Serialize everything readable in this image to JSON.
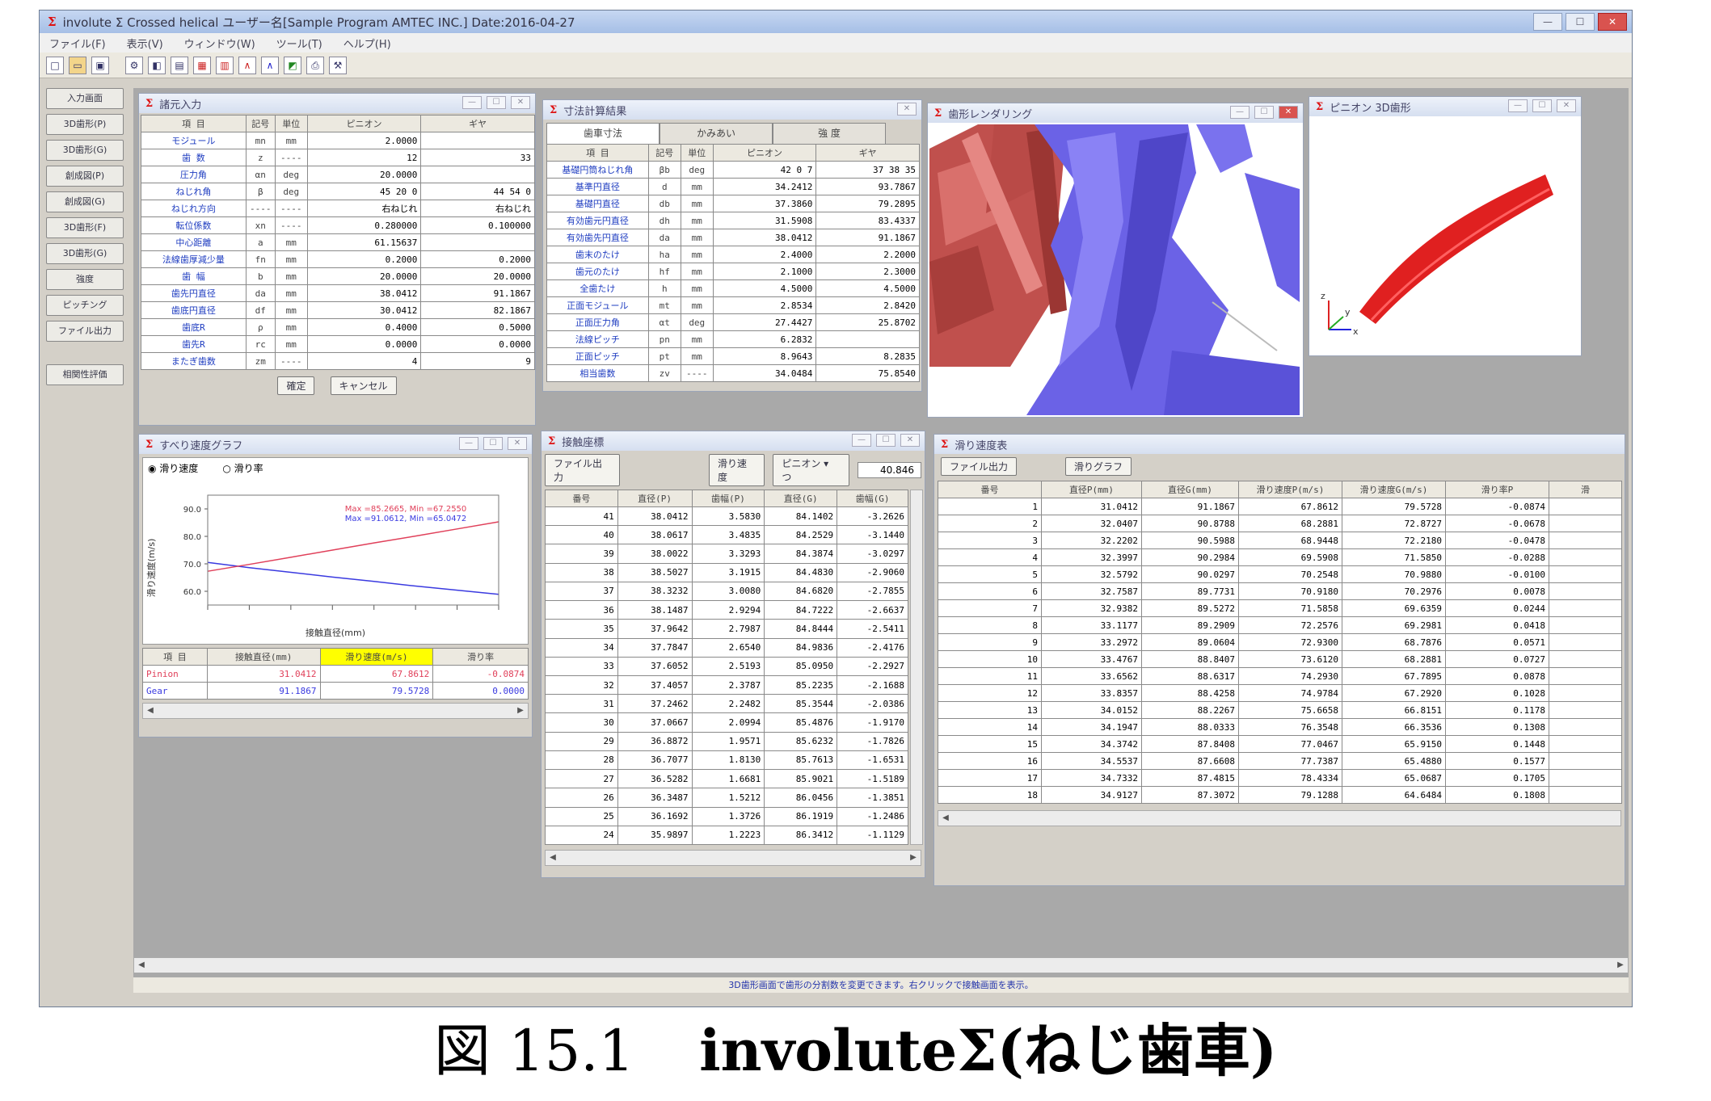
{
  "app": {
    "title": "involute Σ Crossed helical  ユーザー名[Sample Program AMTEC INC.]  Date:2016-04-27",
    "menus": [
      "ファイル(F)",
      "表示(V)",
      "ウィンドウ(W)",
      "ツール(T)",
      "ヘルプ(H)"
    ],
    "toolbar_icons": [
      "new-file-icon",
      "open-folder-icon",
      "save-icon",
      "gear-image-icon",
      "tool-1-icon",
      "tool-2-icon",
      "graph-1-icon",
      "graph-2-icon",
      "graph-3-icon",
      "graph-4-icon",
      "graph-5-icon",
      "print-icon",
      "settings-icon"
    ],
    "status": "3D歯形画面で歯形の分割数を変更できます。右クリックで接触画面を表示。"
  },
  "left_buttons": [
    "入力画面",
    "3D歯形(P)",
    "3D歯形(G)",
    "創成図(P)",
    "創成図(G)",
    "3D歯形(F)",
    "3D歯形(G)",
    "強度",
    "ピッチング",
    "ファイル出力",
    "相関性評価"
  ],
  "input_panel": {
    "title": "諸元入力",
    "headers": [
      "項 目",
      "記号",
      "単位",
      "ピニオン",
      "ギヤ"
    ],
    "rows": [
      {
        "label": "モジュール",
        "sym": "mn",
        "unit": "mm",
        "p": "2.0000",
        "g": ""
      },
      {
        "label": "歯 数",
        "sym": "z",
        "unit": "----",
        "p": "12",
        "g": "33"
      },
      {
        "label": "圧力角",
        "sym": "αn",
        "unit": "deg",
        "p": "20.0000",
        "g": ""
      },
      {
        "label": "ねじれ角",
        "sym": "β",
        "unit": "deg",
        "p": "45  20  0",
        "g": "44  54  0"
      },
      {
        "label": "ねじれ方向",
        "sym": "----",
        "unit": "----",
        "p": "右ねじれ",
        "g": "右ねじれ"
      },
      {
        "label": "転位係数",
        "sym": "xn",
        "unit": "----",
        "p": "0.280000",
        "g": "0.100000"
      },
      {
        "label": "中心距離",
        "sym": "a",
        "unit": "mm",
        "p": "61.15637",
        "g": ""
      },
      {
        "label": "法線歯厚減少量",
        "sym": "fn",
        "unit": "mm",
        "p": "0.2000",
        "g": "0.2000"
      },
      {
        "label": "歯 幅",
        "sym": "b",
        "unit": "mm",
        "p": "20.0000",
        "g": "20.0000"
      },
      {
        "label": "歯先円直径",
        "sym": "da",
        "unit": "mm",
        "p": "38.0412",
        "g": "91.1867"
      },
      {
        "label": "歯底円直径",
        "sym": "df",
        "unit": "mm",
        "p": "30.0412",
        "g": "82.1867"
      },
      {
        "label": "歯底R",
        "sym": "ρ",
        "unit": "mm",
        "p": "0.4000",
        "g": "0.5000"
      },
      {
        "label": "歯先R",
        "sym": "rc",
        "unit": "mm",
        "p": "0.0000",
        "g": "0.0000"
      },
      {
        "label": "またぎ歯数",
        "sym": "zm",
        "unit": "----",
        "p": "4",
        "g": "9"
      }
    ],
    "ok_label": "確定",
    "cancel_label": "キャンセル"
  },
  "dim_panel": {
    "title": "寸法計算結果",
    "tabs": [
      "歯車寸法",
      "かみあい",
      "強 度"
    ],
    "headers": [
      "項 目",
      "記号",
      "単位",
      "ピニオン",
      "ギヤ"
    ],
    "rows": [
      {
        "label": "基礎円筒ねじれ角",
        "sym": "βb",
        "unit": "deg",
        "p": "42  0  7",
        "g": "37  38  35"
      },
      {
        "label": "基準円直径",
        "sym": "d",
        "unit": "mm",
        "p": "34.2412",
        "g": "93.7867"
      },
      {
        "label": "基礎円直径",
        "sym": "db",
        "unit": "mm",
        "p": "37.3860",
        "g": "79.2895"
      },
      {
        "label": "有効歯元円直径",
        "sym": "dh",
        "unit": "mm",
        "p": "31.5908",
        "g": "83.4337"
      },
      {
        "label": "有効歯先円直径",
        "sym": "da",
        "unit": "mm",
        "p": "38.0412",
        "g": "91.1867"
      },
      {
        "label": "歯末のたけ",
        "sym": "ha",
        "unit": "mm",
        "p": "2.4000",
        "g": "2.2000"
      },
      {
        "label": "歯元のたけ",
        "sym": "hf",
        "unit": "mm",
        "p": "2.1000",
        "g": "2.3000"
      },
      {
        "label": "全歯たけ",
        "sym": "h",
        "unit": "mm",
        "p": "4.5000",
        "g": "4.5000"
      },
      {
        "label": "正面モジュール",
        "sym": "mt",
        "unit": "mm",
        "p": "2.8534",
        "g": "2.8420"
      },
      {
        "label": "正面圧力角",
        "sym": "αt",
        "unit": "deg",
        "p": "27.4427",
        "g": "25.8702"
      },
      {
        "label": "法線ピッチ",
        "sym": "pn",
        "unit": "mm",
        "p": "6.2832",
        "g": ""
      },
      {
        "label": "正面ピッチ",
        "sym": "pt",
        "unit": "mm",
        "p": "8.9643",
        "g": "8.2835"
      },
      {
        "label": "相当歯数",
        "sym": "zv",
        "unit": "----",
        "p": "34.0484",
        "g": "75.8540"
      }
    ]
  },
  "render_panel": {
    "title": "歯形レンダリング"
  },
  "pinion3d_panel": {
    "title": "ピニオン 3D歯形",
    "axis_x": "x",
    "axis_y": "y",
    "axis_z": "z"
  },
  "slip_graph": {
    "title": "すべり速度グラフ",
    "radio_velocity": "滑り速度",
    "radio_ratio": "滑り率",
    "ylabel": "滑り速度(m/s)",
    "xlabel": "接触直径(mm)",
    "legend_pinion": "Max =85.2665,  Min =67.2550",
    "legend_gear": "Max =91.0612,  Min =65.0472",
    "table_headers": [
      "項 目",
      "接触直径(mm)",
      "滑り速度(m/s)",
      "滑り率"
    ],
    "table_rows": [
      {
        "name": "Pinion",
        "d": "31.0412",
        "v": "67.8612",
        "r": "-0.0874"
      },
      {
        "name": "Gear",
        "d": "91.1867",
        "v": "79.5728",
        "r": "0.0000"
      }
    ]
  },
  "chart_data": {
    "type": "line",
    "title": "",
    "xlabel": "接触直径(mm)",
    "ylabel": "滑り速度(m/s)",
    "y_ticks": [
      "90.0",
      "80.0",
      "70.0",
      "60.0"
    ],
    "x_tick_count": 8,
    "ylim": [
      55,
      95
    ],
    "x": [
      0,
      1,
      2,
      3,
      4,
      5,
      6,
      7
    ],
    "series": [
      {
        "color": "#e0405a",
        "values": [
          67.3,
          69.8,
          72.4,
          75.0,
          77.6,
          80.1,
          82.7,
          85.3
        ]
      },
      {
        "color": "#3a3ae0",
        "values": [
          70.5,
          68.6,
          66.9,
          65.2,
          63.6,
          61.9,
          60.4,
          58.9
        ]
      }
    ]
  },
  "contact_panel": {
    "title": "接触座標",
    "file_btn": "ファイル出力",
    "slip_btn": "滑り速度",
    "selector": "ピニオン ▾ つ",
    "value": "40.846",
    "headers": [
      "番号",
      "直径(P)",
      "歯幅(P)",
      "直径(G)",
      "歯幅(G)"
    ],
    "rows": [
      [
        "41",
        "38.0412",
        "3.5830",
        "84.1402",
        "-3.2626"
      ],
      [
        "40",
        "38.0617",
        "3.4835",
        "84.2529",
        "-3.1440"
      ],
      [
        "39",
        "38.0022",
        "3.3293",
        "84.3874",
        "-3.0297"
      ],
      [
        "38",
        "38.5027",
        "3.1915",
        "84.4830",
        "-2.9060"
      ],
      [
        "37",
        "38.3232",
        "3.0080",
        "84.6820",
        "-2.7855"
      ],
      [
        "36",
        "38.1487",
        "2.9294",
        "84.7222",
        "-2.6637"
      ],
      [
        "35",
        "37.9642",
        "2.7987",
        "84.8444",
        "-2.5411"
      ],
      [
        "34",
        "37.7847",
        "2.6540",
        "84.9836",
        "-2.4176"
      ],
      [
        "33",
        "37.6052",
        "2.5193",
        "85.0950",
        "-2.2927"
      ],
      [
        "32",
        "37.4057",
        "2.3787",
        "85.2235",
        "-2.1688"
      ],
      [
        "31",
        "37.2462",
        "2.2482",
        "85.3544",
        "-2.0386"
      ],
      [
        "30",
        "37.0667",
        "2.0994",
        "85.4876",
        "-1.9170"
      ],
      [
        "29",
        "36.8872",
        "1.9571",
        "85.6232",
        "-1.7826"
      ],
      [
        "28",
        "36.7077",
        "1.8130",
        "85.7613",
        "-1.6531"
      ],
      [
        "27",
        "36.5282",
        "1.6681",
        "85.9021",
        "-1.5189"
      ],
      [
        "26",
        "36.3487",
        "1.5212",
        "86.0456",
        "-1.3851"
      ],
      [
        "25",
        "36.1692",
        "1.3726",
        "86.1919",
        "-1.2486"
      ],
      [
        "24",
        "35.9897",
        "1.2223",
        "86.3412",
        "-1.1129"
      ]
    ]
  },
  "slip_table": {
    "title": "滑り速度表",
    "file_btn": "ファイル出力",
    "graph_btn": "滑りグラフ",
    "headers": [
      "番号",
      "直径P(mm)",
      "直径G(mm)",
      "滑り速度P(m/s)",
      "滑り速度G(m/s)",
      "滑り率P",
      "滑"
    ],
    "rows": [
      [
        "1",
        "31.0412",
        "91.1867",
        "67.8612",
        "79.5728",
        "-0.0874"
      ],
      [
        "2",
        "32.0407",
        "90.8788",
        "68.2881",
        "72.8727",
        "-0.0678"
      ],
      [
        "3",
        "32.2202",
        "90.5988",
        "68.9448",
        "72.2180",
        "-0.0478"
      ],
      [
        "4",
        "32.3997",
        "90.2984",
        "69.5908",
        "71.5850",
        "-0.0288"
      ],
      [
        "5",
        "32.5792",
        "90.0297",
        "70.2548",
        "70.9880",
        "-0.0100"
      ],
      [
        "6",
        "32.7587",
        "89.7731",
        "70.9180",
        "70.2976",
        "0.0078"
      ],
      [
        "7",
        "32.9382",
        "89.5272",
        "71.5858",
        "69.6359",
        "0.0244"
      ],
      [
        "8",
        "33.1177",
        "89.2909",
        "72.2576",
        "69.2981",
        "0.0418"
      ],
      [
        "9",
        "33.2972",
        "89.0604",
        "72.9300",
        "68.7876",
        "0.0571"
      ],
      [
        "10",
        "33.4767",
        "88.8407",
        "73.6120",
        "68.2881",
        "0.0727"
      ],
      [
        "11",
        "33.6562",
        "88.6317",
        "74.2930",
        "67.7895",
        "0.0878"
      ],
      [
        "12",
        "33.8357",
        "88.4258",
        "74.9784",
        "67.2920",
        "0.1028"
      ],
      [
        "13",
        "34.0152",
        "88.2267",
        "75.6658",
        "66.8151",
        "0.1178"
      ],
      [
        "14",
        "34.1947",
        "88.0333",
        "76.3548",
        "66.3536",
        "0.1308"
      ],
      [
        "15",
        "34.3742",
        "87.8408",
        "77.0467",
        "65.9150",
        "0.1448"
      ],
      [
        "16",
        "34.5537",
        "87.6608",
        "77.7387",
        "65.4880",
        "0.1577"
      ],
      [
        "17",
        "34.7332",
        "87.4815",
        "78.4334",
        "65.0687",
        "0.1705"
      ],
      [
        "18",
        "34.9127",
        "87.3072",
        "79.1288",
        "64.6484",
        "0.1808"
      ]
    ]
  },
  "caption": {
    "number": "図 15.1",
    "title": "involuteΣ(ねじ歯車)"
  }
}
